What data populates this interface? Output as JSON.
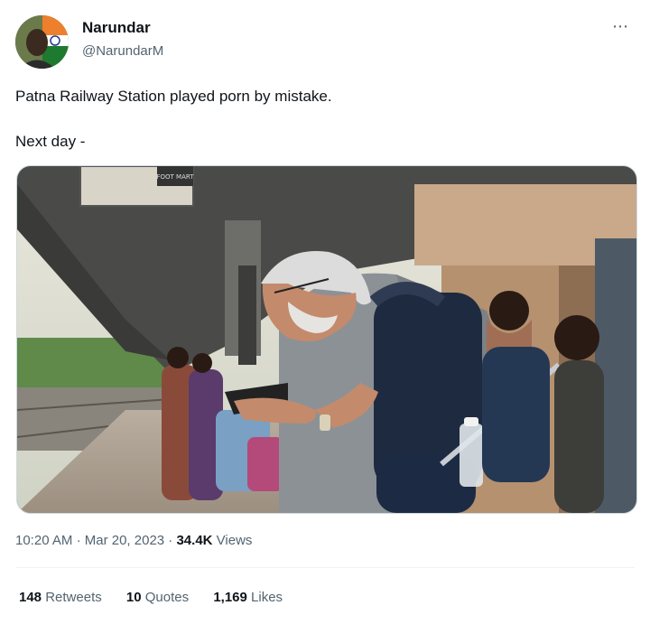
{
  "author": {
    "name": "Narundar",
    "handle": "@NarundarM"
  },
  "more_icon": "⋯",
  "tweet": {
    "line1": "Patna Railway Station played porn by mistake.",
    "line2": "Next day -"
  },
  "media": {
    "sign_text": "FOOT MART"
  },
  "meta": {
    "time": "10:20 AM",
    "separator": "·",
    "date": "Mar 20, 2023",
    "views_count": "34.4K",
    "views_label": "Views"
  },
  "stats": {
    "retweets_count": "148",
    "retweets_label": "Retweets",
    "quotes_count": "10",
    "quotes_label": "Quotes",
    "likes_count": "1,169",
    "likes_label": "Likes"
  },
  "colors": {
    "text": "#0f1419",
    "secondary": "#536471",
    "border": "#cfd9de"
  }
}
